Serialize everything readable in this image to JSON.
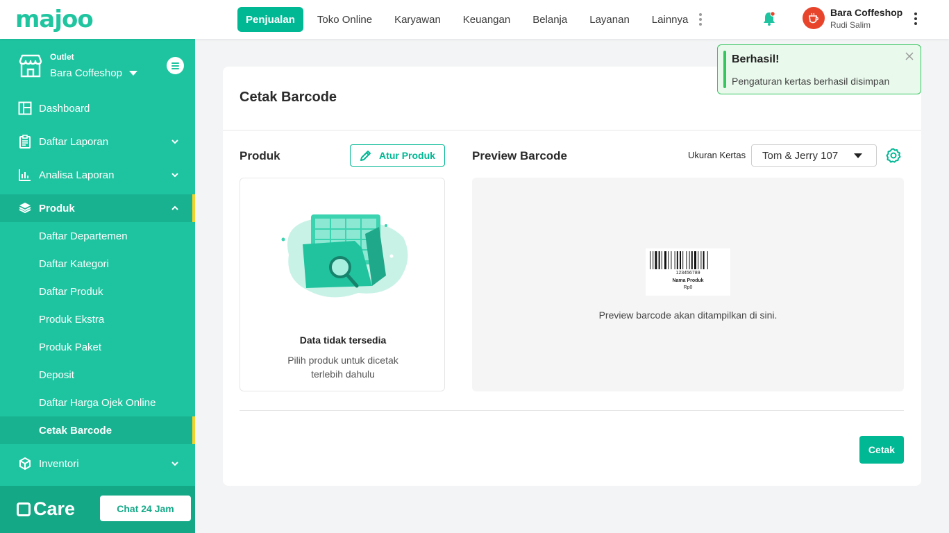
{
  "app": {
    "logo_text": "majoo"
  },
  "topnav": {
    "items": [
      "Penjualan",
      "Toko Online",
      "Karyawan",
      "Keuangan",
      "Belanja",
      "Layanan",
      "Lainnya"
    ],
    "active": "Penjualan"
  },
  "user": {
    "name": "Bara Coffeshop",
    "subtitle": "Rudi Salim"
  },
  "sidebar": {
    "outlet_label": "Outlet",
    "outlet_name": "Bara Coffeshop",
    "items": {
      "dashboard": "Dashboard",
      "daftar_laporan": "Daftar Laporan",
      "analisa_laporan": "Analisa Laporan",
      "produk": "Produk",
      "inventori": "Inventori"
    },
    "produk_sub": [
      "Daftar Departemen",
      "Daftar Kategori",
      "Daftar Produk",
      "Produk Ekstra",
      "Produk Paket",
      "Deposit",
      "Daftar Harga Ojek Online",
      "Cetak Barcode"
    ],
    "active_sub": "Cetak Barcode",
    "care_text": "Care",
    "chat_button": "Chat 24 Jam"
  },
  "page": {
    "title": "Cetak Barcode",
    "produk_title": "Produk",
    "atur_produk_button": "Atur Produk",
    "empty_title": "Data tidak tersedia",
    "empty_desc": "Pilih produk untuk dicetak terlebih dahulu",
    "preview_title": "Preview Barcode",
    "ukuran_label": "Ukuran Kertas",
    "ukuran_value": "Tom & Jerry 107",
    "barcode_number": "123456789",
    "barcode_product": "Nama Produk",
    "barcode_price": "Rp0",
    "preview_text": "Preview barcode akan ditampilkan di sini.",
    "cetak_button": "Cetak"
  },
  "toast": {
    "title": "Berhasil!",
    "message": "Pengaturan kertas berhasil disimpan"
  },
  "colors": {
    "brand": "#00b894",
    "sidebar": "#1ec4a0",
    "sidebar_active": "#19b291",
    "active_indicator": "#f5d22a",
    "toast_border": "#34c75e"
  }
}
